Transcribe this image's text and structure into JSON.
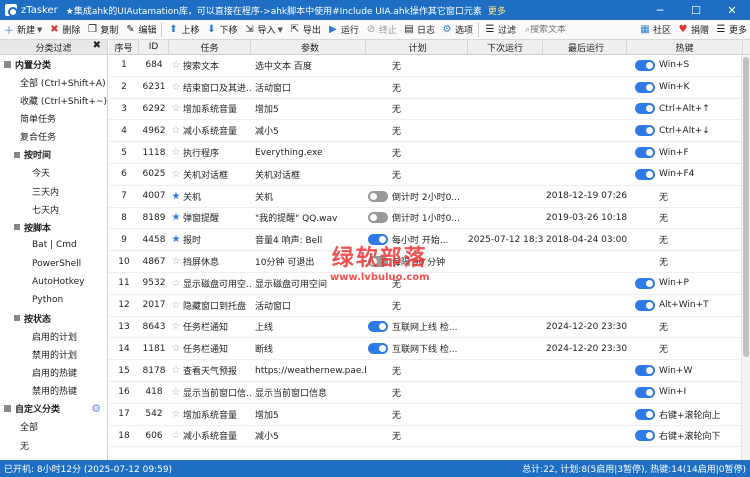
{
  "window": {
    "title": "zTasker",
    "notice": "★集成ahk的UIAutamation库，可以直接在程序->ahk脚本中使用#Include UIA.ahk操作其它窗口元素",
    "more": "更多"
  },
  "toolbar": {
    "new": "新建",
    "delete": "删除",
    "copy": "复制",
    "edit": "编辑",
    "up": "上移",
    "down": "下移",
    "import": "导入",
    "export": "导出",
    "run": "运行",
    "stop": "终止",
    "log": "日志",
    "options": "选项",
    "filter": "过滤",
    "search_placeholder": "搜索文本",
    "community": "社区",
    "donate": "捐赠",
    "more": "更多"
  },
  "sidebar": {
    "header": "分类过滤",
    "builtin": "内置分类",
    "all": "全部 (Ctrl+Shift+A)",
    "fav": "收藏 (Ctrl+Shift+~)",
    "simple": "简单任务",
    "composite": "复合任务",
    "by_time": "按时间",
    "today": "今天",
    "three_days": "三天内",
    "seven_days": "七天内",
    "by_script": "按脚本",
    "bat": "Bat | Cmd",
    "powershell": "PowerShell",
    "autohotkey": "AutoHotkey",
    "python": "Python",
    "by_status": "按状态",
    "enabled_plans": "启用的计划",
    "disabled_plans": "禁用的计划",
    "enabled_hotkeys": "启用的热键",
    "disabled_hotkeys": "禁用的热键",
    "custom": "自定义分类",
    "custom_all": "全部",
    "none": "无"
  },
  "columns": [
    "序号",
    "ID",
    "任务",
    "参数",
    "计划",
    "下次运行",
    "最后运行",
    "热键"
  ],
  "rows": [
    {
      "seq": "1",
      "id": "684",
      "star": false,
      "task": "搜索文本",
      "param": "选中文本 百度",
      "plan": "无",
      "plan_toggle": "",
      "next": "",
      "last": "",
      "hotkey": "Win+S",
      "hk_toggle": "on"
    },
    {
      "seq": "2",
      "id": "6231",
      "star": false,
      "task": "结束窗口及其进...",
      "param": "活动窗口",
      "plan": "无",
      "plan_toggle": "",
      "next": "",
      "last": "",
      "hotkey": "Win+K",
      "hk_toggle": "on"
    },
    {
      "seq": "3",
      "id": "6292",
      "star": false,
      "task": "增加系统音量",
      "param": "增加5",
      "plan": "无",
      "plan_toggle": "",
      "next": "",
      "last": "",
      "hotkey": "Ctrl+Alt+↑",
      "hk_toggle": "on"
    },
    {
      "seq": "4",
      "id": "4962",
      "star": false,
      "task": "减小系统音量",
      "param": "减小5",
      "plan": "无",
      "plan_toggle": "",
      "next": "",
      "last": "",
      "hotkey": "Ctrl+Alt+↓",
      "hk_toggle": "on"
    },
    {
      "seq": "5",
      "id": "1118",
      "star": false,
      "task": "执行程序",
      "param": "Everything.exe",
      "plan": "无",
      "plan_toggle": "",
      "next": "",
      "last": "",
      "hotkey": "Win+F",
      "hk_toggle": "on"
    },
    {
      "seq": "6",
      "id": "6025",
      "star": false,
      "task": "关机对话框",
      "param": "关机对话框",
      "plan": "无",
      "plan_toggle": "",
      "next": "",
      "last": "",
      "hotkey": "Win+F4",
      "hk_toggle": "on"
    },
    {
      "seq": "7",
      "id": "4007",
      "star": true,
      "task": "关机",
      "param": "关机",
      "plan": "倒计时 2小时0...",
      "plan_toggle": "off",
      "next": "",
      "last": "2018-12-19 07:26:18",
      "hotkey": "无",
      "hk_toggle": ""
    },
    {
      "seq": "8",
      "id": "8189",
      "star": true,
      "task": "弹窗提醒",
      "param": "\"我的提醒\" QQ.wav",
      "plan": "倒计时 1小时0...",
      "plan_toggle": "off",
      "next": "",
      "last": "2019-03-26 10:18:11",
      "hotkey": "无",
      "hk_toggle": ""
    },
    {
      "seq": "9",
      "id": "4458",
      "star": true,
      "task": "报时",
      "param": "音量4 响声: Bell",
      "plan": "每小时 开始...",
      "plan_toggle": "on",
      "next": "2025-07-12 18:30:00...",
      "last": "2018-04-24 03:00:00",
      "hotkey": "无",
      "hk_toggle": ""
    },
    {
      "seq": "10",
      "id": "4867",
      "star": false,
      "task": "挡屏休息",
      "param": "10分钟 可退出",
      "plan": "每隔 90 分钟",
      "plan_toggle": "off",
      "next": "",
      "last": "",
      "hotkey": "无",
      "hk_toggle": ""
    },
    {
      "seq": "11",
      "id": "9532",
      "star": false,
      "task": "显示磁盘可用空...",
      "param": "显示磁盘可用空间",
      "plan": "无",
      "plan_toggle": "",
      "next": "",
      "last": "",
      "hotkey": "Win+P",
      "hk_toggle": "on"
    },
    {
      "seq": "12",
      "id": "2017",
      "star": false,
      "task": "隐藏窗口到托盘",
      "param": "活动窗口",
      "plan": "无",
      "plan_toggle": "",
      "next": "",
      "last": "",
      "hotkey": "Alt+Win+T",
      "hk_toggle": "on"
    },
    {
      "seq": "13",
      "id": "8643",
      "star": false,
      "task": "任务栏通知",
      "param": "上线",
      "plan": "互联网上线 检...",
      "plan_toggle": "on",
      "next": "",
      "last": "2024-12-20 23:30:44",
      "hotkey": "无",
      "hk_toggle": ""
    },
    {
      "seq": "14",
      "id": "1181",
      "star": false,
      "task": "任务栏通知",
      "param": "断线",
      "plan": "互联网下线 检...",
      "plan_toggle": "on",
      "next": "",
      "last": "2024-12-20 23:30:52",
      "hotkey": "无",
      "hk_toggle": ""
    },
    {
      "seq": "15",
      "id": "8178",
      "star": false,
      "task": "查看天气预报",
      "param": "https://weathernew.pae.bai...",
      "plan": "无",
      "plan_toggle": "",
      "next": "",
      "last": "",
      "hotkey": "Win+W",
      "hk_toggle": "on"
    },
    {
      "seq": "16",
      "id": "418",
      "star": false,
      "task": "显示当前窗口信...",
      "param": "显示当前窗口信息",
      "plan": "无",
      "plan_toggle": "",
      "next": "",
      "last": "",
      "hotkey": "Win+I",
      "hk_toggle": "on"
    },
    {
      "seq": "17",
      "id": "542",
      "star": false,
      "task": "增加系统音量",
      "param": "增加5",
      "plan": "无",
      "plan_toggle": "",
      "next": "",
      "last": "",
      "hotkey": "右键+滚轮向上",
      "hk_toggle": "on"
    },
    {
      "seq": "18",
      "id": "606",
      "star": false,
      "task": "减小系统音量",
      "param": "减小5",
      "plan": "无",
      "plan_toggle": "",
      "next": "",
      "last": "",
      "hotkey": "右键+滚轮向下",
      "hk_toggle": "on"
    }
  ],
  "status": {
    "left": "已开机: 8小时12分 (2025-07-12 09:59)",
    "right": "总计:22, 计划:8(5启用|3暂停), 热键:14(14启用|0暂停)"
  },
  "watermark": {
    "line1": "绿软部落",
    "line2": "www.lvbuluo.com"
  }
}
